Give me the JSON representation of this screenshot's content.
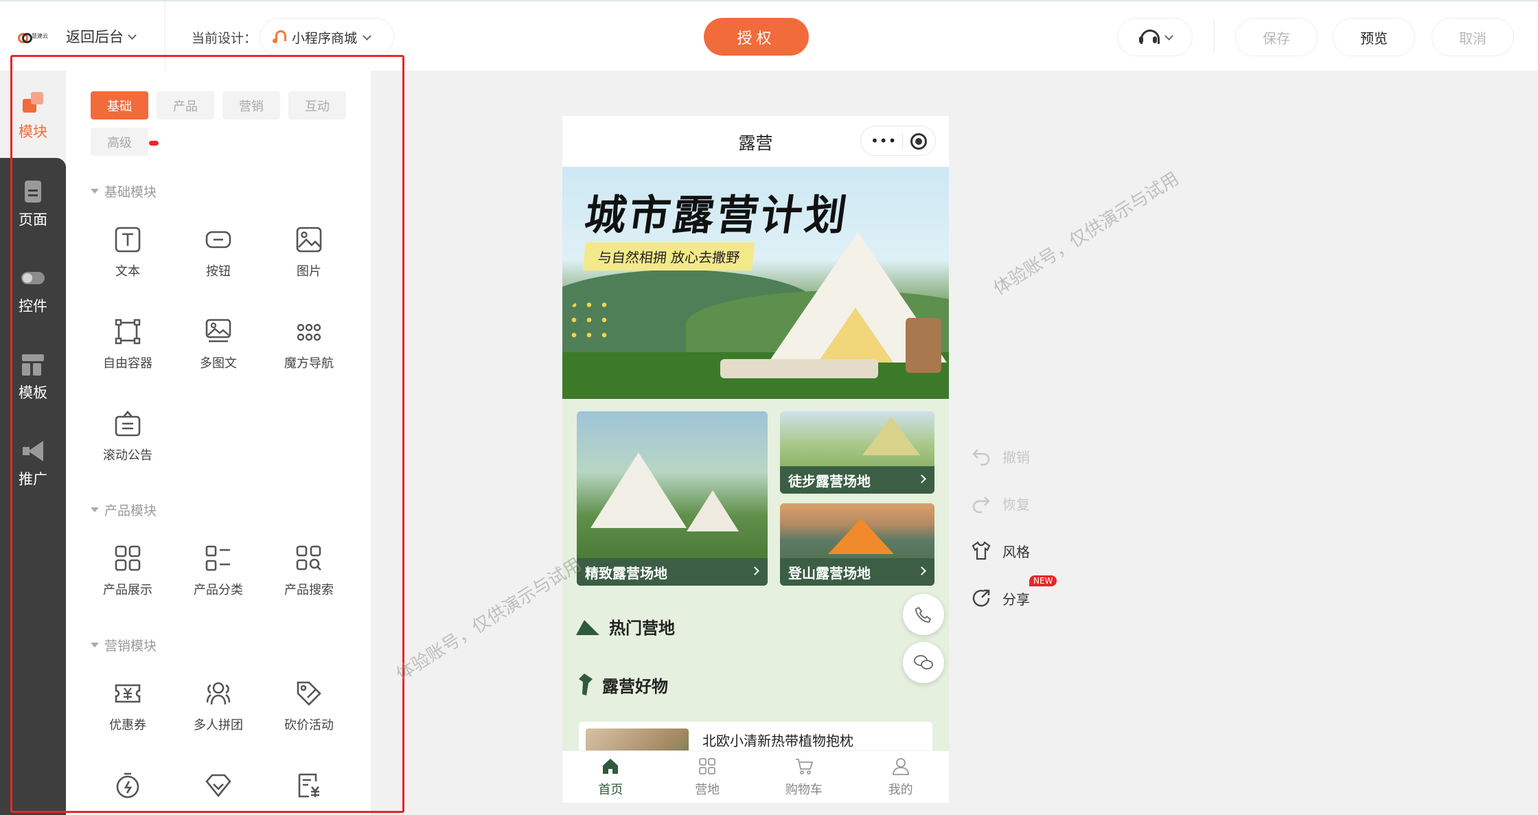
{
  "topbar": {
    "logo_text": "慧建云",
    "back_label": "返回后台",
    "current_design_label": "当前设计：",
    "design_name": "小程序商城",
    "auth_label": "授权",
    "save_label": "保存",
    "preview_label": "预览",
    "cancel_label": "取消"
  },
  "rail": {
    "items": [
      {
        "label": "模块",
        "icon": "module-icon",
        "active": true
      },
      {
        "label": "页面",
        "icon": "page-icon"
      },
      {
        "label": "控件",
        "icon": "toggle-icon"
      },
      {
        "label": "模板",
        "icon": "template-icon"
      },
      {
        "label": "推广",
        "icon": "megaphone-icon"
      }
    ]
  },
  "panel": {
    "tabs": [
      "基础",
      "产品",
      "营销",
      "互动",
      "高级"
    ],
    "active_tab": "基础",
    "sections": [
      {
        "title": "基础模块",
        "items": [
          "文本",
          "按钮",
          "图片",
          "自由容器",
          "多图文",
          "魔方导航",
          "滚动公告"
        ]
      },
      {
        "title": "产品模块",
        "items": [
          "产品展示",
          "产品分类",
          "产品搜索"
        ]
      },
      {
        "title": "营销模块",
        "items": [
          "优惠券",
          "多人拼团",
          "砍价活动"
        ]
      }
    ]
  },
  "phone": {
    "title": "露营",
    "banner_title": "城市露营计划",
    "banner_subtitle": "与自然相拥 放心去撒野",
    "cards": [
      "精致露营场地",
      "徒步露营场地",
      "登山露营场地"
    ],
    "section_hot": "热门营地",
    "section_goods": "露营好物",
    "product_name": "北欧小清新热带植物抱枕",
    "tabbar": [
      "首页",
      "营地",
      "购物车",
      "我的"
    ]
  },
  "actions": {
    "undo": "撤销",
    "redo": "恢复",
    "style": "风格",
    "share": "分享",
    "share_badge": "NEW"
  },
  "watermark": "体验账号，仅供演示与试用",
  "colors": {
    "accent": "#f26b3a",
    "rail_bg": "#3e3e3e",
    "phone_bg": "#e6f0de",
    "card_caption": "#3b5e45",
    "highlight_frame": "#e8262a"
  }
}
